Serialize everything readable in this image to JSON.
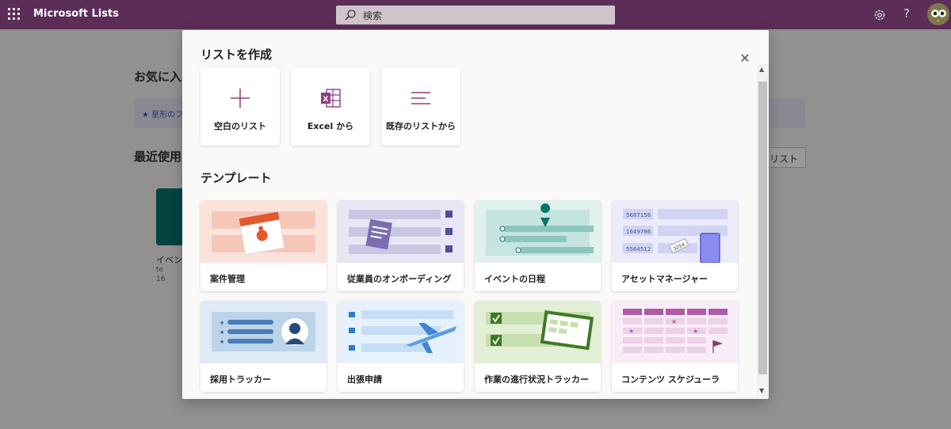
{
  "app": {
    "name": "Microsoft Lists"
  },
  "search": {
    "placeholder": "検索"
  },
  "background": {
    "favorites_title": "お気に入",
    "favorites_hint": "星形のフ",
    "recent_title": "最近使用",
    "list_button": "リスト",
    "tile_label": "イベン",
    "tile_sub1": "te",
    "tile_sub2": "16"
  },
  "modal": {
    "title": "リストを作成",
    "create_options": [
      {
        "label": "空白のリスト",
        "icon": "plus-icon"
      },
      {
        "label": "Excel から",
        "icon": "excel-icon"
      },
      {
        "label": "既存のリストから",
        "icon": "list-lines-icon"
      }
    ],
    "templates_title": "テンプレート",
    "templates": [
      {
        "label": "案件管理",
        "icon": "calendar-bug-illustration"
      },
      {
        "label": "従業員のオンボーディング",
        "icon": "clipboard-checklist-illustration"
      },
      {
        "label": "イベントの日程",
        "icon": "map-pin-timeline-illustration"
      },
      {
        "label": "アセットマネージャー",
        "icon": "asset-phone-illustration"
      },
      {
        "label": "採用トラッカー",
        "icon": "candidate-profile-illustration"
      },
      {
        "label": "出張申請",
        "icon": "airplane-illustration"
      },
      {
        "label": "作業の進行状況トラッカー",
        "icon": "progress-board-illustration"
      },
      {
        "label": "コンテンツ スケジューラ",
        "icon": "content-calendar-illustration"
      }
    ],
    "asset_numbers": [
      "5687156",
      "1649786",
      "5564512"
    ],
    "asset_tag": "3254"
  },
  "colors": {
    "suite_bar": "#5c2d57",
    "accent": "#8c3f84",
    "teal": "#07746d"
  }
}
